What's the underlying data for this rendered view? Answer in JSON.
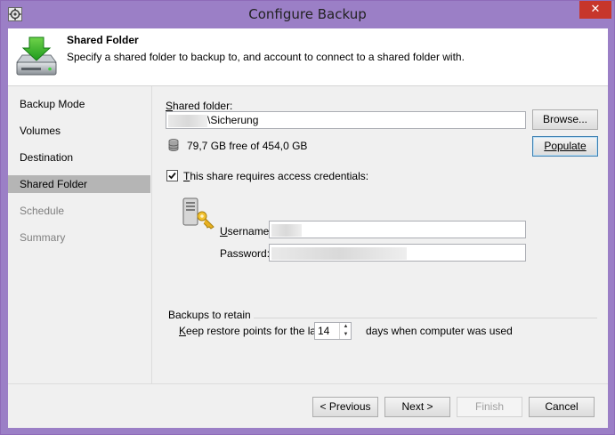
{
  "window": {
    "title": "Configure Backup",
    "close_label": "✕"
  },
  "header": {
    "title": "Shared Folder",
    "description": "Specify a shared folder to backup to, and account to connect to a shared folder with."
  },
  "sidebar": {
    "items": [
      {
        "label": "Backup Mode",
        "state": "normal"
      },
      {
        "label": "Volumes",
        "state": "normal"
      },
      {
        "label": "Destination",
        "state": "normal"
      },
      {
        "label": "Shared Folder",
        "state": "selected"
      },
      {
        "label": "Schedule",
        "state": "disabled"
      },
      {
        "label": "Summary",
        "state": "disabled"
      }
    ]
  },
  "shared_folder": {
    "label_access_key": "S",
    "label_rest": "hared folder:",
    "path_suffix": "\\Sicherung",
    "browse_label": "Browse...",
    "free_space": "79,7 GB free of 454,0 GB",
    "populate_label": "Populate"
  },
  "credentials": {
    "checkbox_access_key": "T",
    "checkbox_rest": "his share requires access credentials:",
    "checked": true,
    "username_access_key": "U",
    "username_rest": "sername:",
    "password_access_key": "",
    "password_label": "Password:"
  },
  "retain": {
    "group_title": "Backups to retain",
    "keep_access_key": "K",
    "keep_rest": "eep restore points for the last",
    "days_value": "14",
    "days_suffix": "days when computer was used"
  },
  "footer": {
    "previous_label": "< Previous",
    "next_label": "Next >",
    "finish_label": "Finish",
    "cancel_label": "Cancel"
  },
  "colors": {
    "titlebar": "#9b7fc6",
    "close_button": "#c7362b",
    "selected_nav": "#b5b5b5",
    "focus_border": "#3c7fb1"
  }
}
